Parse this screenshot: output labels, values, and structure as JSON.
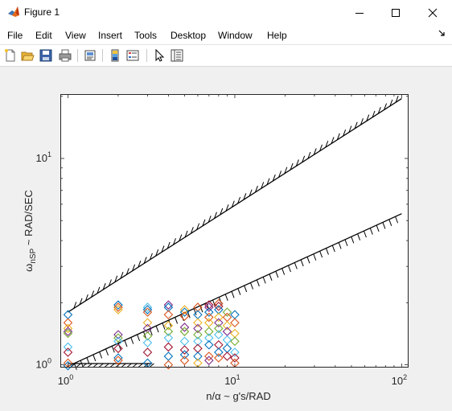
{
  "window": {
    "title": "Figure 1"
  },
  "menu": [
    "File",
    "Edit",
    "View",
    "Insert",
    "Tools",
    "Desktop",
    "Window",
    "Help"
  ],
  "toolbar_icons": [
    "new-figure-icon",
    "open-file-icon",
    "save-icon",
    "print-icon",
    "print-preview-icon",
    "link-plot-icon",
    "insert-legend-icon",
    "pointer-icon",
    "property-inspector-icon"
  ],
  "chart_data": {
    "type": "scatter",
    "xscale": "log",
    "yscale": "log",
    "xlim": [
      0.9,
      110
    ],
    "ylim": [
      0.97,
      20.5
    ],
    "xlabel": "n/α ~ g's/RAD",
    "ylabel_main": "ω",
    "ylabel_sub": "nSP",
    "ylabel_rest": " ~ RAD/SEC",
    "xticks": [
      {
        "value": 1,
        "base": "10",
        "exp": "0"
      },
      {
        "value": 10,
        "base": "10",
        "exp": "1"
      },
      {
        "value": 100,
        "base": "10",
        "exp": "2"
      }
    ],
    "yticks": [
      {
        "value": 1,
        "base": "10",
        "exp": "0"
      },
      {
        "value": 10,
        "base": "10",
        "exp": "1"
      }
    ],
    "boundary_lines": [
      {
        "name": "upper limit",
        "points": [
          [
            1,
            1.8
          ],
          [
            100,
            19.5
          ]
        ],
        "hatch": "above"
      },
      {
        "name": "lower limit",
        "points": [
          [
            1,
            0.985
          ],
          [
            100,
            5.4
          ]
        ],
        "hatch": "below"
      }
    ],
    "marker": "diamond",
    "series_colors": [
      "#0072BD",
      "#D95319",
      "#EDB120",
      "#7E2F8E",
      "#77AC30",
      "#4DBEEE",
      "#A2142F"
    ],
    "points": [
      [
        1,
        1.75,
        0
      ],
      [
        1,
        1.6,
        1
      ],
      [
        1,
        1.5,
        2
      ],
      [
        1,
        1.45,
        3
      ],
      [
        1,
        1.42,
        4
      ],
      [
        1,
        1.22,
        5
      ],
      [
        1,
        1.15,
        6
      ],
      [
        1,
        0.99,
        0
      ],
      [
        1,
        1.02,
        1
      ],
      [
        2,
        1.95,
        0
      ],
      [
        2,
        1.9,
        1
      ],
      [
        2,
        1.85,
        2
      ],
      [
        2,
        1.4,
        3
      ],
      [
        2,
        1.35,
        4
      ],
      [
        2,
        1.3,
        5
      ],
      [
        2,
        1.2,
        6
      ],
      [
        2,
        1.08,
        0
      ],
      [
        2,
        1.05,
        1
      ],
      [
        3,
        1.9,
        5
      ],
      [
        3,
        1.85,
        0
      ],
      [
        3,
        1.8,
        1
      ],
      [
        3,
        1.6,
        2
      ],
      [
        3,
        1.5,
        3
      ],
      [
        3,
        1.38,
        4
      ],
      [
        3,
        1.28,
        5
      ],
      [
        3,
        1.15,
        6
      ],
      [
        3,
        1.02,
        0
      ],
      [
        4,
        1.95,
        3
      ],
      [
        4,
        1.9,
        0
      ],
      [
        4,
        1.75,
        1
      ],
      [
        4,
        1.55,
        2
      ],
      [
        4,
        1.45,
        4
      ],
      [
        4,
        1.35,
        5
      ],
      [
        4,
        1.22,
        6
      ],
      [
        4,
        1.1,
        0
      ],
      [
        4,
        1.0,
        1
      ],
      [
        5,
        1.85,
        2
      ],
      [
        5,
        1.8,
        0
      ],
      [
        5,
        1.72,
        1
      ],
      [
        5,
        1.52,
        3
      ],
      [
        5,
        1.45,
        4
      ],
      [
        5,
        1.3,
        5
      ],
      [
        5,
        1.18,
        6
      ],
      [
        5,
        1.12,
        0
      ],
      [
        5,
        1.05,
        1
      ],
      [
        6,
        1.9,
        1
      ],
      [
        6,
        1.75,
        0
      ],
      [
        6,
        1.6,
        2
      ],
      [
        6,
        1.5,
        3
      ],
      [
        6,
        1.4,
        4
      ],
      [
        6,
        1.3,
        5
      ],
      [
        6,
        1.2,
        6
      ],
      [
        6,
        1.1,
        0
      ],
      [
        6,
        1.02,
        2
      ],
      [
        7,
        1.95,
        6
      ],
      [
        7,
        1.9,
        3
      ],
      [
        7,
        1.8,
        0
      ],
      [
        7,
        1.7,
        1
      ],
      [
        7,
        1.6,
        2
      ],
      [
        7,
        1.45,
        4
      ],
      [
        7,
        1.35,
        5
      ],
      [
        7,
        1.25,
        0
      ],
      [
        7,
        1.1,
        1
      ],
      [
        7,
        1.05,
        3
      ],
      [
        8,
        1.98,
        1
      ],
      [
        8,
        1.92,
        6
      ],
      [
        8,
        1.85,
        0
      ],
      [
        8,
        1.7,
        2
      ],
      [
        8,
        1.6,
        3
      ],
      [
        8,
        1.5,
        4
      ],
      [
        8,
        1.4,
        5
      ],
      [
        8,
        1.25,
        6
      ],
      [
        8,
        1.15,
        0
      ],
      [
        8,
        1.08,
        1
      ],
      [
        9,
        1.8,
        4
      ],
      [
        9,
        1.7,
        1
      ],
      [
        9,
        1.55,
        2
      ],
      [
        9,
        1.45,
        3
      ],
      [
        9,
        1.32,
        5
      ],
      [
        9,
        1.2,
        0
      ],
      [
        9,
        1.1,
        6
      ],
      [
        10,
        1.75,
        0
      ],
      [
        10,
        1.6,
        1
      ],
      [
        10,
        1.42,
        2
      ],
      [
        10,
        1.3,
        4
      ],
      [
        10,
        1.15,
        5
      ],
      [
        10,
        1.08,
        6
      ],
      [
        10,
        1.02,
        1
      ]
    ]
  }
}
